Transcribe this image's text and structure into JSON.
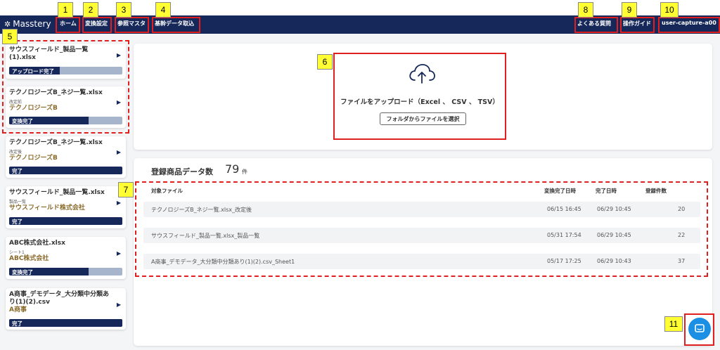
{
  "header": {
    "logo": "Masstery",
    "nav": {
      "home": "ホーム",
      "convert": "変換設定",
      "reference": "参照マスタ",
      "import": "基幹データ取込",
      "faq": "よくある質問",
      "guide": "操作ガイド",
      "user": "user-capture-a00"
    }
  },
  "sidebar": {
    "cards": [
      {
        "file": "サウスフィールド_製品一覧(1).xlsx",
        "sub": "",
        "company": "",
        "status": "アップロード完了",
        "progress": 0.45
      },
      {
        "file": "テクノロジーズB_ネジ一覧.xlsx",
        "sub": "改定前",
        "company": "テクノロジーズB",
        "status": "変換完了",
        "progress": 0.7
      },
      {
        "file": "テクノロジーズB_ネジ一覧.xlsx",
        "sub": "改定後",
        "company": "テクノロジーズB",
        "status": "完了",
        "progress": 1.0
      },
      {
        "file": "サウスフィールド_製品一覧.xlsx",
        "sub": "製品一覧",
        "company": "サウスフィールド株式会社",
        "status": "完了",
        "progress": 1.0
      },
      {
        "file": "ABC株式会社.xlsx",
        "sub": "シート1",
        "company": "ABC株式会社",
        "status": "変換完了",
        "progress": 0.7
      },
      {
        "file": "A商事_デモデータ_大分類中分類あり(1)(2).csv",
        "sub": "",
        "company": "A商事",
        "status": "完了",
        "progress": 1.0
      }
    ]
  },
  "upload": {
    "title": "ファイルをアップロード（Excel 、 CSV 、 TSV）",
    "button": "フォルダからファイルを選択"
  },
  "registry": {
    "title": "登録商品データ数",
    "count": "79",
    "unit": "件",
    "headers": {
      "file": "対象ファイル",
      "converted": "変換完了日時",
      "completed": "完了日時",
      "records": "登録件数"
    },
    "rows": [
      {
        "file": "テクノロジーズB_ネジ一覧.xlsx_改定後",
        "converted": "06/15 16:45",
        "completed": "06/29 10:45",
        "records": "20"
      },
      {
        "file": "サウスフィールド_製品一覧.xlsx_製品一覧",
        "converted": "05/31 17:54",
        "completed": "06/29 10:45",
        "records": "22"
      },
      {
        "file": "A商事_デモデータ_大分類中分類あり(1)(2).csv_Sheet1",
        "converted": "05/17 17:25",
        "completed": "06/29 10:43",
        "records": "37"
      }
    ]
  },
  "annotations": [
    "1",
    "2",
    "3",
    "4",
    "5",
    "6",
    "7",
    "8",
    "9",
    "10",
    "11"
  ],
  "icons": {
    "upload": "cloud-upload-icon",
    "chat": "chat-icon",
    "chevron": "chevron-down-icon",
    "arrow": "play-arrow-icon"
  },
  "colors": {
    "header": "#16285a",
    "accent": "#1a8fe3",
    "annotation": "#e02020",
    "tag": "#ffff33",
    "company": "#8a6a2a"
  }
}
